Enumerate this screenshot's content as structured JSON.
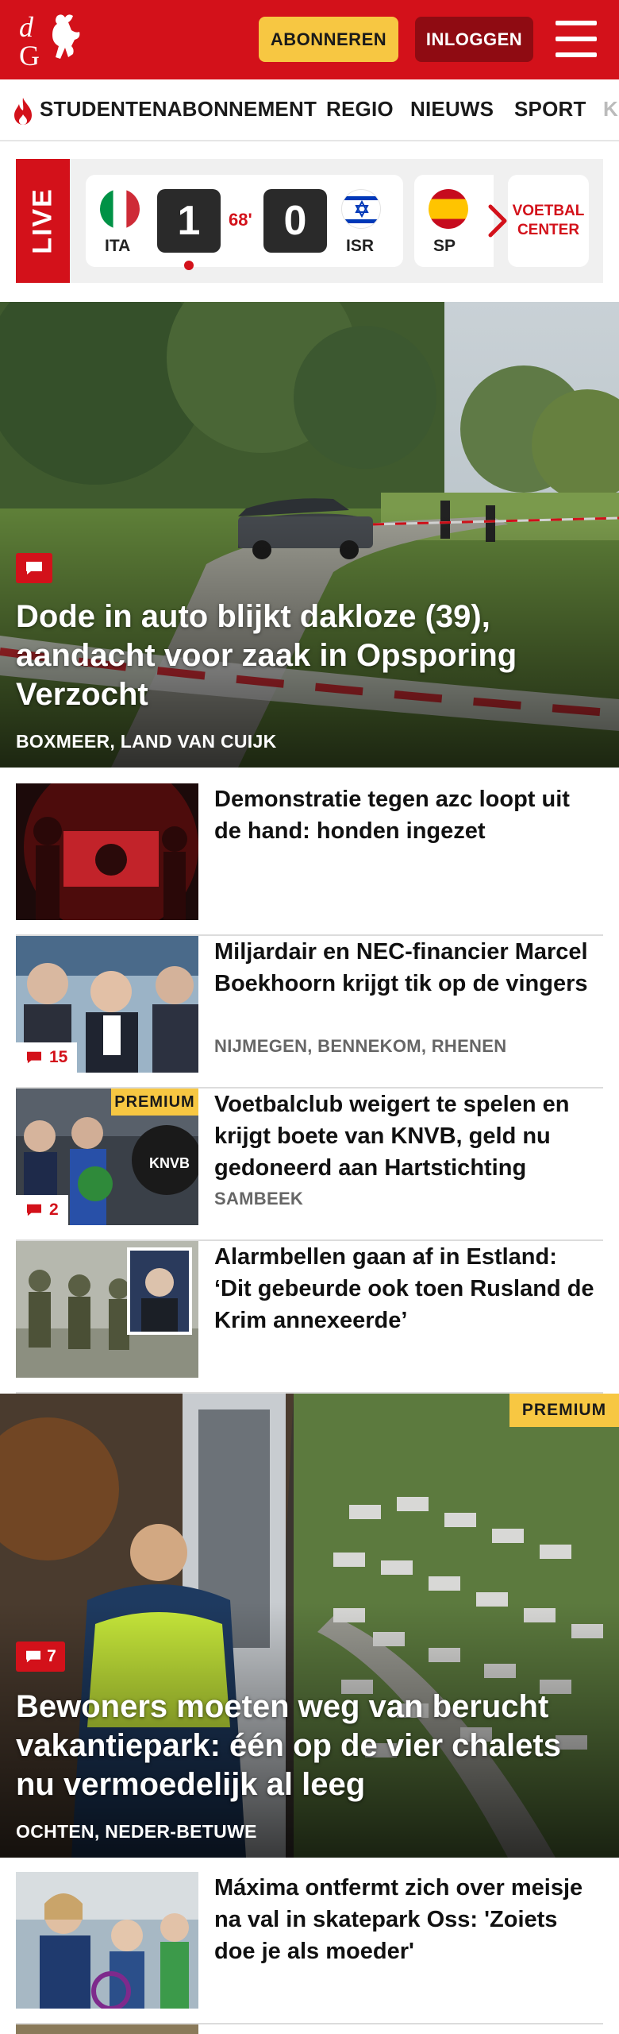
{
  "header": {
    "logo_text": "dG",
    "subscribe_label": "ABONNEREN",
    "login_label": "INLOGGEN",
    "menu_icon": "hamburger-menu-icon",
    "brand_color": "#d3111a"
  },
  "nav": {
    "items": [
      {
        "label": "STUDENTENABONNEMENT",
        "icon": "flame-icon"
      },
      {
        "label": "REGIO"
      },
      {
        "label": "NIEUWS"
      },
      {
        "label": "SPORT"
      },
      {
        "label": "K"
      }
    ]
  },
  "live": {
    "label": "LIVE",
    "match": {
      "home_code": "ITA",
      "home_score": "1",
      "minute": "68'",
      "away_score": "0",
      "away_code": "ISR"
    },
    "next_match_code": "SP",
    "center_label_line1": "VOETBAL",
    "center_label_line2": "CENTER"
  },
  "hero": {
    "title": "Dode in auto blijkt dakloze (39), aandacht voor zaak in Opsporing Verzocht",
    "location": "BOXMEER, LAND VAN CUIJK",
    "comment_icon": "comment-icon"
  },
  "articles": [
    {
      "title": "Demonstratie tegen azc loopt uit de hand: honden ingezet",
      "location": "",
      "comments": "",
      "premium": false
    },
    {
      "title": "Miljardair en NEC-financier Marcel Boekhoorn krijgt tik op de vingers",
      "location": "NIJMEGEN, BENNEKOM, RHENEN",
      "comments": "15",
      "premium": false
    },
    {
      "title": "Voetbalclub weigert te spelen en krijgt boete van KNVB, geld nu gedoneerd aan Hartstichting",
      "location": "SAMBEEK",
      "comments": "2",
      "premium": true,
      "premium_label": "PREMIUM"
    },
    {
      "title": "Alarmbellen gaan af in Estland: ‘Dit gebeurde ook toen Rusland de Krim annexeerde’",
      "location": "",
      "comments": "",
      "premium": false
    }
  ],
  "hero2": {
    "premium_label": "PREMIUM",
    "comments": "7",
    "title": "Bewoners moeten weg van berucht vakantiepark: één op de vier chalets nu vermoedelijk al leeg",
    "location": "OCHTEN, NEDER-BETUWE"
  },
  "articles2": [
    {
      "title": "Máxima ontfermt zich over meisje na val in skatepark Oss: 'Zoiets doe je als moeder'",
      "location": "",
      "comments": ""
    }
  ]
}
